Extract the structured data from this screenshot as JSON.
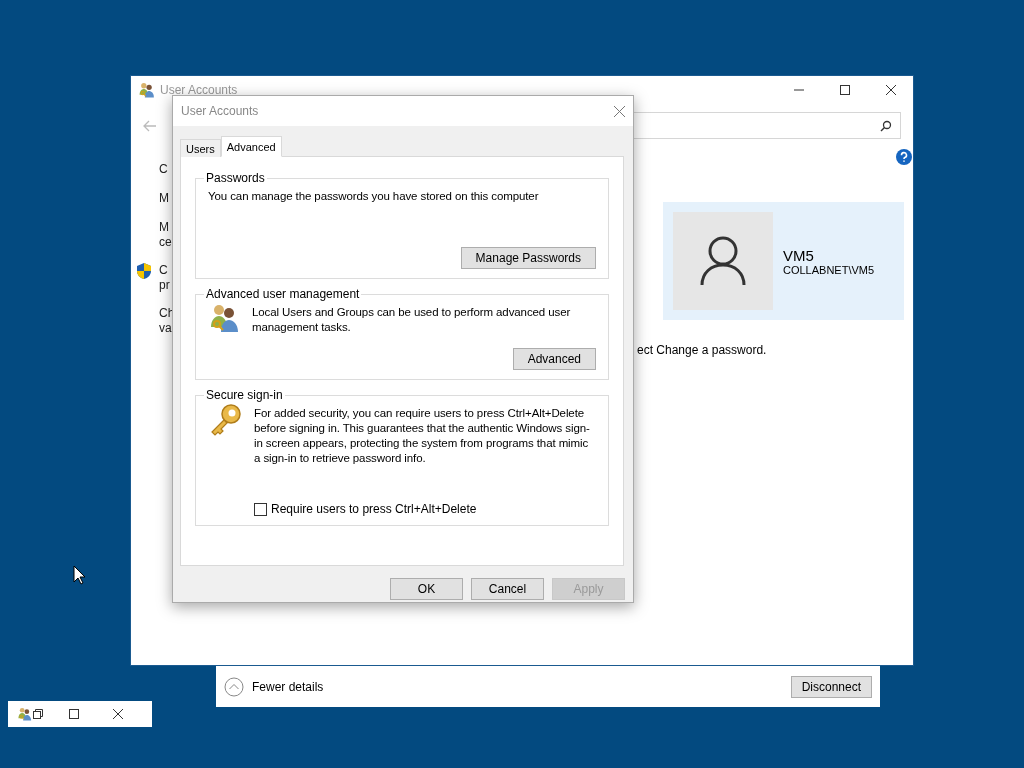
{
  "background_window": {
    "title": "User Accounts",
    "side_links": [
      {
        "lines": [
          "C"
        ],
        "shield": false
      },
      {
        "lines": [
          "M"
        ],
        "shield": false
      },
      {
        "lines": [
          "M",
          "ce"
        ],
        "shield": false
      },
      {
        "lines": [
          "C",
          "pr"
        ],
        "shield": true
      },
      {
        "lines": [
          "Ch",
          "va"
        ],
        "shield": false
      }
    ],
    "account": {
      "name": "VM5",
      "domain": "COLLABNET\\VM5"
    },
    "instruction": "ect Change a password."
  },
  "dialog": {
    "title": "User Accounts",
    "tabs": [
      {
        "label": "Users",
        "selected": false
      },
      {
        "label": "Advanced",
        "selected": true
      }
    ],
    "groups": [
      {
        "kind": "plain",
        "title": "Passwords",
        "text": "You can manage the passwords you have stored on this computer",
        "button": "Manage Passwords"
      },
      {
        "kind": "users",
        "title": "Advanced user management",
        "text": "Local Users and Groups can be used to perform advanced user management tasks.",
        "button": "Advanced"
      },
      {
        "kind": "key",
        "title": "Secure sign-in",
        "text": "For added security, you can require users to press Ctrl+Alt+Delete before signing in. This guarantees that the authentic Windows sign-in screen appears, protecting the system from programs that mimic a sign-in to retrieve password info.",
        "checkbox": {
          "label": "Require users to press Ctrl+Alt+Delete",
          "checked": false
        }
      }
    ],
    "buttons": [
      {
        "label": "OK",
        "disabled": false
      },
      {
        "label": "Cancel",
        "disabled": false
      },
      {
        "label": "Apply",
        "disabled": true
      }
    ]
  },
  "remote_bar": {
    "toggle": "Fewer details",
    "button": "Disconnect"
  }
}
